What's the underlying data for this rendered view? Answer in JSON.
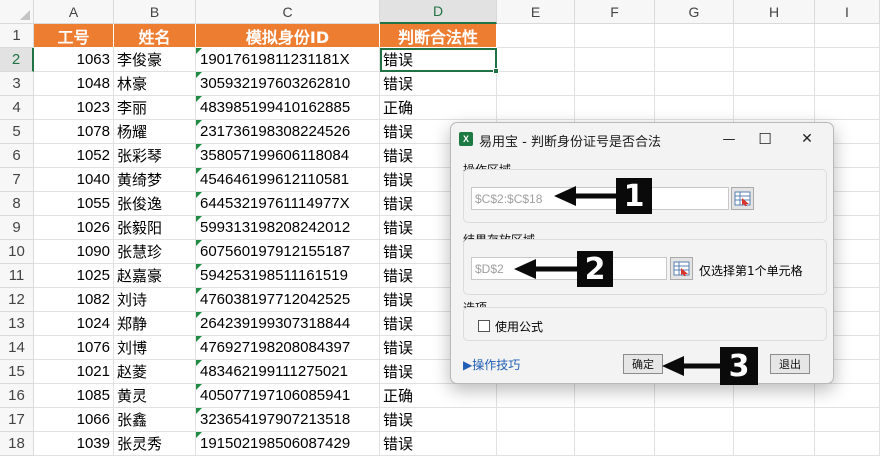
{
  "columns": [
    "A",
    "B",
    "C",
    "D",
    "E",
    "F",
    "G",
    "H",
    "I"
  ],
  "rows": [
    "1",
    "2",
    "3",
    "4",
    "5",
    "6",
    "7",
    "8",
    "9",
    "10",
    "11",
    "12",
    "13",
    "14",
    "15",
    "16",
    "17",
    "18"
  ],
  "table": {
    "headers": [
      "工号",
      "姓名",
      "模拟身份ID",
      "判断合法性"
    ],
    "records": [
      {
        "id": "1063",
        "name": "李俊豪",
        "card": "19017619811231181X",
        "result": "错误"
      },
      {
        "id": "1048",
        "name": "林豪",
        "card": "305932197603262810",
        "result": "错误"
      },
      {
        "id": "1023",
        "name": "李丽",
        "card": "483985199410162885",
        "result": "正确"
      },
      {
        "id": "1078",
        "name": "杨耀",
        "card": "231736198308224526",
        "result": "错误"
      },
      {
        "id": "1052",
        "name": "张彩琴",
        "card": "358057199606118084",
        "result": "错误"
      },
      {
        "id": "1040",
        "name": "黄绮梦",
        "card": "454646199612110581",
        "result": "错误"
      },
      {
        "id": "1055",
        "name": "张俊逸",
        "card": "64453219761114977X",
        "result": "错误"
      },
      {
        "id": "1026",
        "name": "张毅阳",
        "card": "599313198208242012",
        "result": "错误"
      },
      {
        "id": "1090",
        "name": "张慧珍",
        "card": "607560197912155187",
        "result": "错误"
      },
      {
        "id": "1025",
        "name": "赵嘉豪",
        "card": "594253198511161519",
        "result": "错误"
      },
      {
        "id": "1082",
        "name": "刘诗",
        "card": "476038197712042525",
        "result": "错误"
      },
      {
        "id": "1024",
        "name": "郑静",
        "card": "264239199307318844",
        "result": "错误"
      },
      {
        "id": "1076",
        "name": "刘博",
        "card": "476927198208084397",
        "result": "错误"
      },
      {
        "id": "1021",
        "name": "赵菱",
        "card": "483462199111275021",
        "result": "错误"
      },
      {
        "id": "1085",
        "name": "黄灵",
        "card": "405077197106085941",
        "result": "正确"
      },
      {
        "id": "1066",
        "name": "张鑫",
        "card": "323654197907213518",
        "result": "错误"
      },
      {
        "id": "1039",
        "name": "张灵秀",
        "card": "191502198506087429",
        "result": "错误"
      }
    ]
  },
  "dialog": {
    "title": "易用宝 - 判断身份证号是否合法",
    "icon_letter": "X",
    "operation_area_label": "操作区域",
    "operation_area_value": "$C$2:$C$18",
    "result_area_label": "结果存放区域",
    "result_area_value": "$D$2",
    "result_area_hint": "仅选择第1个单元格",
    "options_label": "选项",
    "use_formula_label": "使用公式",
    "use_formula_checked": false,
    "tips_link": "▶操作技巧",
    "ok_label": "确定",
    "exit_label": "退出",
    "minimize_glyph": "—",
    "maximize_glyph": "☐",
    "close_glyph": "✕"
  },
  "callouts": [
    "1",
    "2",
    "3"
  ],
  "colors": {
    "header_fill": "#ed7d31",
    "header_text": "#ffffff",
    "selection": "#217346",
    "callout": "#0a0a0a",
    "link": "#1f5fb5"
  }
}
